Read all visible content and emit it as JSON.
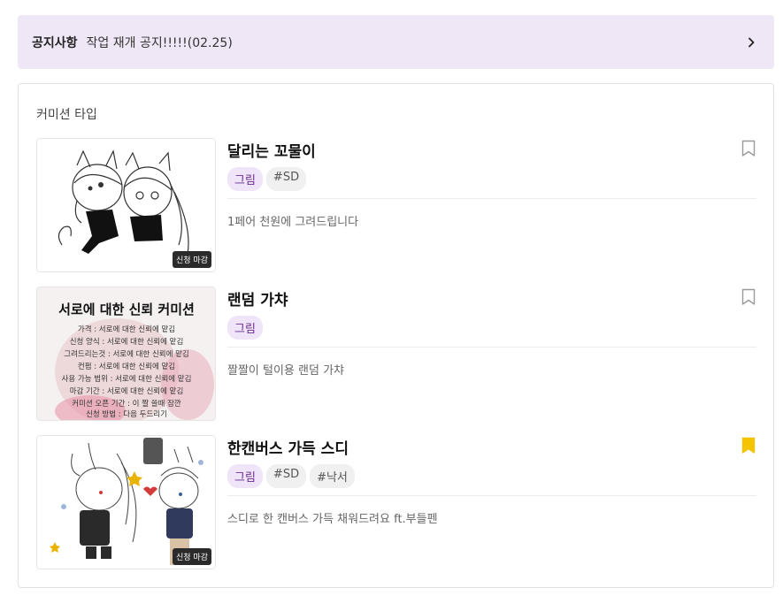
{
  "notice": {
    "label": "공지사항",
    "text": "작업 재개 공지!!!!!(02.25)",
    "icon": "chevron-right-icon"
  },
  "commission_section": {
    "title": "커미션 타입",
    "items": [
      {
        "title": "달리는 꼬물이",
        "tags": [
          "그림",
          "#SD"
        ],
        "description": "1페어 천원에 그려드립니다",
        "badge": "신청 마감",
        "bookmarked": false
      },
      {
        "title": "랜덤 가챠",
        "tags": [
          "그림"
        ],
        "description": "짤짤이 털이용 랜덤 가챠",
        "badge": "",
        "bookmarked": false,
        "poster": {
          "heading": "서로에 대한 신뢰 커미션",
          "lines": [
            "가격 : 서로에 대한 신뢰에 맡김",
            "신청 양식 : 서로에 대한 신뢰에 맡김",
            "그려드리는것 : 서로에 대한 신뢰에 맡김",
            "컨펌 : 서로에 대한 신뢰에 맡김",
            "사용 가능 범위 : 서로에 대한 신뢰에 맡김",
            "마감 기간 : 서로에 대한 신뢰에 맡김",
            "커미션 오픈 기간 : 이 짤 쓸때 잠깐",
            "신청 방법 : 다음 두드리기"
          ]
        }
      },
      {
        "title": "한캔버스 가득 스디",
        "tags": [
          "그림",
          "#SD",
          "#낙서"
        ],
        "description": "스디로 한 캔버스 가득 채워드려요 ft.부들펜",
        "badge": "신청 마감",
        "bookmarked": true
      }
    ]
  },
  "colors": {
    "notice_bg": "#efe7f6",
    "tag_primary_bg": "#efe4f8",
    "tag_primary_text": "#6a2c91",
    "bookmark_active": "#f5c400"
  }
}
